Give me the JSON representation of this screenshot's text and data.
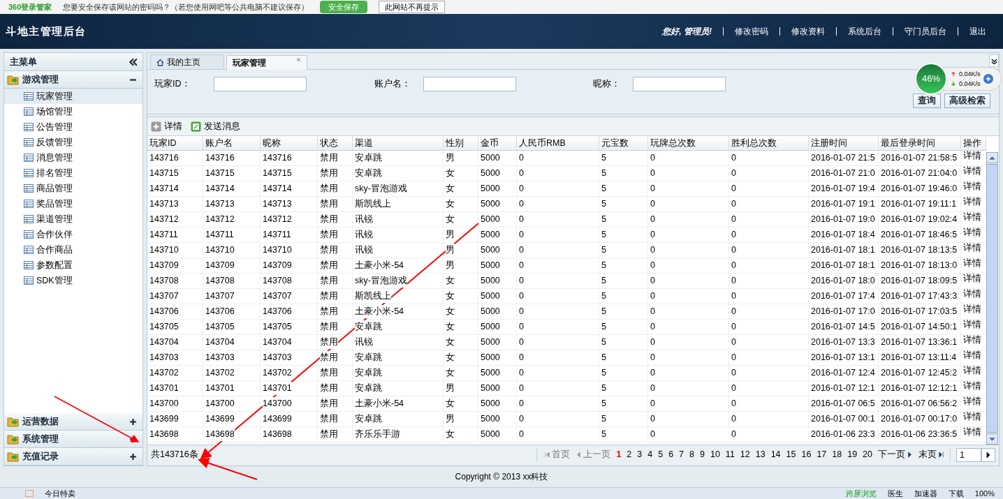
{
  "browser_bar": {
    "brand": "360登录管家",
    "prompt": "您要安全保存该网站的密码吗？（若您使用网吧等公共电脑不建议保存）",
    "save_button": "安全保存",
    "dismiss_button": "此网站不再提示"
  },
  "header": {
    "title": "斗地主管理后台",
    "greeting": "您好, 管理员!",
    "links": [
      "修改密码",
      "修改资料",
      "系统后台",
      "守门员后台",
      "退出"
    ]
  },
  "sidebar": {
    "title": "主菜单",
    "groups": [
      {
        "label": "游戏管理",
        "expanded": true,
        "items": [
          {
            "label": "玩家管理",
            "selected": true
          },
          {
            "label": "场馆管理",
            "selected": false
          },
          {
            "label": "公告管理",
            "selected": false
          },
          {
            "label": "反馈管理",
            "selected": false
          },
          {
            "label": "消息管理",
            "selected": false
          },
          {
            "label": "排名管理",
            "selected": false
          },
          {
            "label": "商品管理",
            "selected": false
          },
          {
            "label": "奖品管理",
            "selected": false
          },
          {
            "label": "渠道管理",
            "selected": false
          },
          {
            "label": "合作伙伴",
            "selected": false
          },
          {
            "label": "合作商品",
            "selected": false
          },
          {
            "label": "参数配置",
            "selected": false
          },
          {
            "label": "SDK管理",
            "selected": false
          }
        ]
      },
      {
        "label": "运营数据",
        "expanded": false
      },
      {
        "label": "系统管理",
        "expanded": false
      },
      {
        "label": "充值记录",
        "expanded": false
      }
    ]
  },
  "tabs": [
    {
      "label": "我的主页",
      "selected": false,
      "kind": "home"
    },
    {
      "label": "玩家管理",
      "selected": true,
      "kind": "closable"
    }
  ],
  "search": {
    "fields": [
      {
        "label": "玩家ID："
      },
      {
        "label": "账户名："
      },
      {
        "label": "昵称："
      }
    ],
    "buttons": [
      "查询",
      "高级检索"
    ]
  },
  "toolbar": [
    {
      "label": "详情",
      "kind": "detail"
    },
    {
      "label": "发送消息",
      "kind": "message"
    }
  ],
  "table": {
    "columns": [
      "玩家ID",
      "账户名",
      "昵称",
      "状态",
      "渠道",
      "性别",
      "金币",
      "人民币RMB",
      "元宝数",
      "玩牌总次数",
      "胜利总次数",
      "注册时间",
      "最后登录时间",
      "操作"
    ],
    "rows": [
      [
        "143716",
        "143716",
        "143716",
        "禁用",
        "安卓跳",
        "男",
        "5000",
        "0",
        "5",
        "0",
        "0",
        "2016-01-07 21:5",
        "2016-01-07 21:58:5",
        "详情"
      ],
      [
        "143715",
        "143715",
        "143715",
        "禁用",
        "安卓跳",
        "女",
        "5000",
        "0",
        "5",
        "0",
        "0",
        "2016-01-07 21:0",
        "2016-01-07 21:04:0",
        "详情"
      ],
      [
        "143714",
        "143714",
        "143714",
        "禁用",
        "sky-冒泡游戏",
        "女",
        "5000",
        "0",
        "5",
        "0",
        "0",
        "2016-01-07 19:4",
        "2016-01-07 19:46:0",
        "详情"
      ],
      [
        "143713",
        "143713",
        "143713",
        "禁用",
        "斯凯线上",
        "女",
        "5000",
        "0",
        "5",
        "0",
        "0",
        "2016-01-07 19:1",
        "2016-01-07 19:11:1",
        "详情"
      ],
      [
        "143712",
        "143712",
        "143712",
        "禁用",
        "讯锐",
        "女",
        "5000",
        "0",
        "5",
        "0",
        "0",
        "2016-01-07 19:0",
        "2016-01-07 19:02:4",
        "详情"
      ],
      [
        "143711",
        "143711",
        "143711",
        "禁用",
        "讯锐",
        "男",
        "5000",
        "0",
        "5",
        "0",
        "0",
        "2016-01-07 18:4",
        "2016-01-07 18:46:5",
        "详情"
      ],
      [
        "143710",
        "143710",
        "143710",
        "禁用",
        "讯锐",
        "男",
        "5000",
        "0",
        "5",
        "0",
        "0",
        "2016-01-07 18:1",
        "2016-01-07 18:13:5",
        "详情"
      ],
      [
        "143709",
        "143709",
        "143709",
        "禁用",
        "土豪小米-54",
        "男",
        "5000",
        "0",
        "5",
        "0",
        "0",
        "2016-01-07 18:1",
        "2016-01-07 18:13:0",
        "详情"
      ],
      [
        "143708",
        "143708",
        "143708",
        "禁用",
        "sky-冒泡游戏",
        "女",
        "5000",
        "0",
        "5",
        "0",
        "0",
        "2016-01-07 18:0",
        "2016-01-07 18:09:5",
        "详情"
      ],
      [
        "143707",
        "143707",
        "143707",
        "禁用",
        "斯凯线上",
        "女",
        "5000",
        "0",
        "5",
        "0",
        "0",
        "2016-01-07 17:4",
        "2016-01-07 17:43:3",
        "详情"
      ],
      [
        "143706",
        "143706",
        "143706",
        "禁用",
        "土豪小米-54",
        "女",
        "5000",
        "0",
        "5",
        "0",
        "0",
        "2016-01-07 17:0",
        "2016-01-07 17:03:5",
        "详情"
      ],
      [
        "143705",
        "143705",
        "143705",
        "禁用",
        "安卓跳",
        "女",
        "5000",
        "0",
        "5",
        "0",
        "0",
        "2016-01-07 14:5",
        "2016-01-07 14:50:1",
        "详情"
      ],
      [
        "143704",
        "143704",
        "143704",
        "禁用",
        "讯锐",
        "女",
        "5000",
        "0",
        "5",
        "0",
        "0",
        "2016-01-07 13:3",
        "2016-01-07 13:36:1",
        "详情"
      ],
      [
        "143703",
        "143703",
        "143703",
        "禁用",
        "安卓跳",
        "女",
        "5000",
        "0",
        "5",
        "0",
        "0",
        "2016-01-07 13:1",
        "2016-01-07 13:11:4",
        "详情"
      ],
      [
        "143702",
        "143702",
        "143702",
        "禁用",
        "安卓跳",
        "女",
        "5000",
        "0",
        "5",
        "0",
        "0",
        "2016-01-07 12:4",
        "2016-01-07 12:45:2",
        "详情"
      ],
      [
        "143701",
        "143701",
        "143701",
        "禁用",
        "安卓跳",
        "男",
        "5000",
        "0",
        "5",
        "0",
        "0",
        "2016-01-07 12:1",
        "2016-01-07 12:12:1",
        "详情"
      ],
      [
        "143700",
        "143700",
        "143700",
        "禁用",
        "土豪小米-54",
        "女",
        "5000",
        "0",
        "5",
        "0",
        "0",
        "2016-01-07 06:5",
        "2016-01-07 06:56:2",
        "详情"
      ],
      [
        "143699",
        "143699",
        "143699",
        "禁用",
        "安卓跳",
        "男",
        "5000",
        "0",
        "5",
        "0",
        "0",
        "2016-01-07 00:1",
        "2016-01-07 00:17:0",
        "详情"
      ],
      [
        "143698",
        "143698",
        "143698",
        "禁用",
        "齐乐乐手游",
        "女",
        "5000",
        "0",
        "5",
        "0",
        "0",
        "2016-01-06 23:3",
        "2016-01-06 23:36:5",
        "详情"
      ]
    ]
  },
  "pagination": {
    "total": "共143716条",
    "first": "首页",
    "prev": "上一页",
    "pages": [
      {
        "label": "1",
        "selected": true
      },
      {
        "label": "2",
        "selected": false
      },
      {
        "label": "3",
        "selected": false
      },
      {
        "label": "4",
        "selected": false
      },
      {
        "label": "5",
        "selected": false
      },
      {
        "label": "6",
        "selected": false
      },
      {
        "label": "7",
        "selected": false
      },
      {
        "label": "8",
        "selected": false
      },
      {
        "label": "9",
        "selected": false
      },
      {
        "label": "10",
        "selected": false
      },
      {
        "label": "11",
        "selected": false
      },
      {
        "label": "12",
        "selected": false
      },
      {
        "label": "13",
        "selected": false
      },
      {
        "label": "14",
        "selected": false
      },
      {
        "label": "15",
        "selected": false
      },
      {
        "label": "16",
        "selected": false
      },
      {
        "label": "17",
        "selected": false
      },
      {
        "label": "18",
        "selected": false
      },
      {
        "label": "19",
        "selected": false
      },
      {
        "label": "20",
        "selected": false
      }
    ],
    "next": "下一页",
    "last": "末页",
    "page_input": "1"
  },
  "footer": {
    "copyright": "Copyright © 2013 xx科技"
  },
  "speed_widget": {
    "percent": "46%",
    "upload": "0.04K/s",
    "download": "0.04K/s"
  },
  "status_bar": {
    "left": "今日特卖",
    "items": [
      "跨屏浏览",
      "医生",
      "加速器",
      "下载"
    ],
    "zoom": "100%"
  }
}
